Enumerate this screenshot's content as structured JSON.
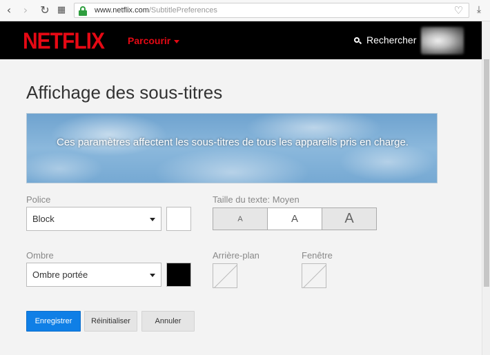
{
  "browser": {
    "url_domain": "www.netflix.com",
    "url_path": "/SubtitlePreferences",
    "back_icon": "‹",
    "forward_icon": "›",
    "reload_icon": "↻",
    "apps_icon": "▦",
    "heart_icon": "♡",
    "download_icon": "⤓"
  },
  "header": {
    "logo": "NETFLIX",
    "browse_label": "Parcourir",
    "search_label": "Rechercher",
    "brand_color": "#e50914"
  },
  "page": {
    "title": "Affichage des sous-titres",
    "banner_text": "Ces paramètres affectent les sous-titres de tous les appareils pris en charge."
  },
  "form": {
    "font_label": "Police",
    "font_value": "Block",
    "font_color": "#ffffff",
    "text_size_label": "Taille du texte: Moyen",
    "text_size_options": [
      "A",
      "A",
      "A"
    ],
    "text_size_selected": 1,
    "shadow_label": "Ombre",
    "shadow_value": "Ombre portée",
    "shadow_color": "#000000",
    "background_label": "Arrière-plan",
    "window_label": "Fenêtre"
  },
  "actions": {
    "save_label": "Enregistrer",
    "reset_label": "Réinitialiser",
    "cancel_label": "Annuler",
    "primary_color": "#0f7fe6"
  }
}
